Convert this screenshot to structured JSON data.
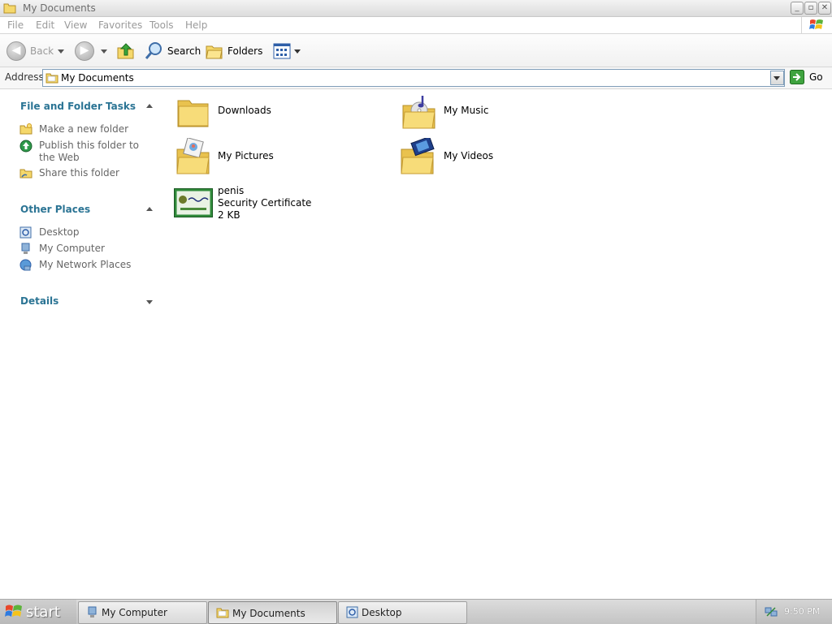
{
  "window": {
    "title": "My Documents"
  },
  "menu": [
    "File",
    "Edit",
    "View",
    "Favorites",
    "Tools",
    "Help"
  ],
  "toolbar": {
    "back_label": "Back",
    "search_label": "Search",
    "folders_label": "Folders"
  },
  "address": {
    "label": "Address",
    "value": "My Documents",
    "go_label": "Go"
  },
  "left_pane": {
    "tasks": {
      "title": "File and Folder Tasks",
      "items": [
        "Make a new folder",
        "Publish this folder to the Web",
        "Share this folder"
      ]
    },
    "other_places": {
      "title": "Other Places",
      "items": [
        "Desktop",
        "My Computer",
        "My Network Places"
      ]
    },
    "details": {
      "title": "Details"
    }
  },
  "items": [
    {
      "name": "Downloads",
      "icon": "folder-icon"
    },
    {
      "name": "My Music",
      "icon": "music-folder-icon"
    },
    {
      "name": "My Pictures",
      "icon": "pictures-folder-icon"
    },
    {
      "name": "My Videos",
      "icon": "videos-folder-icon"
    },
    {
      "name": "penis",
      "type": "Security Certificate",
      "size": "2 KB",
      "icon": "certificate-icon"
    }
  ],
  "taskbar": {
    "start_label": "start",
    "tasks": [
      "My Computer",
      "My Documents",
      "Desktop"
    ],
    "clock": "9:50 PM"
  },
  "colors": {
    "section_title": "#2b7494",
    "address_border": "#7f9db9",
    "folder_yellow": "#f5d86b"
  }
}
